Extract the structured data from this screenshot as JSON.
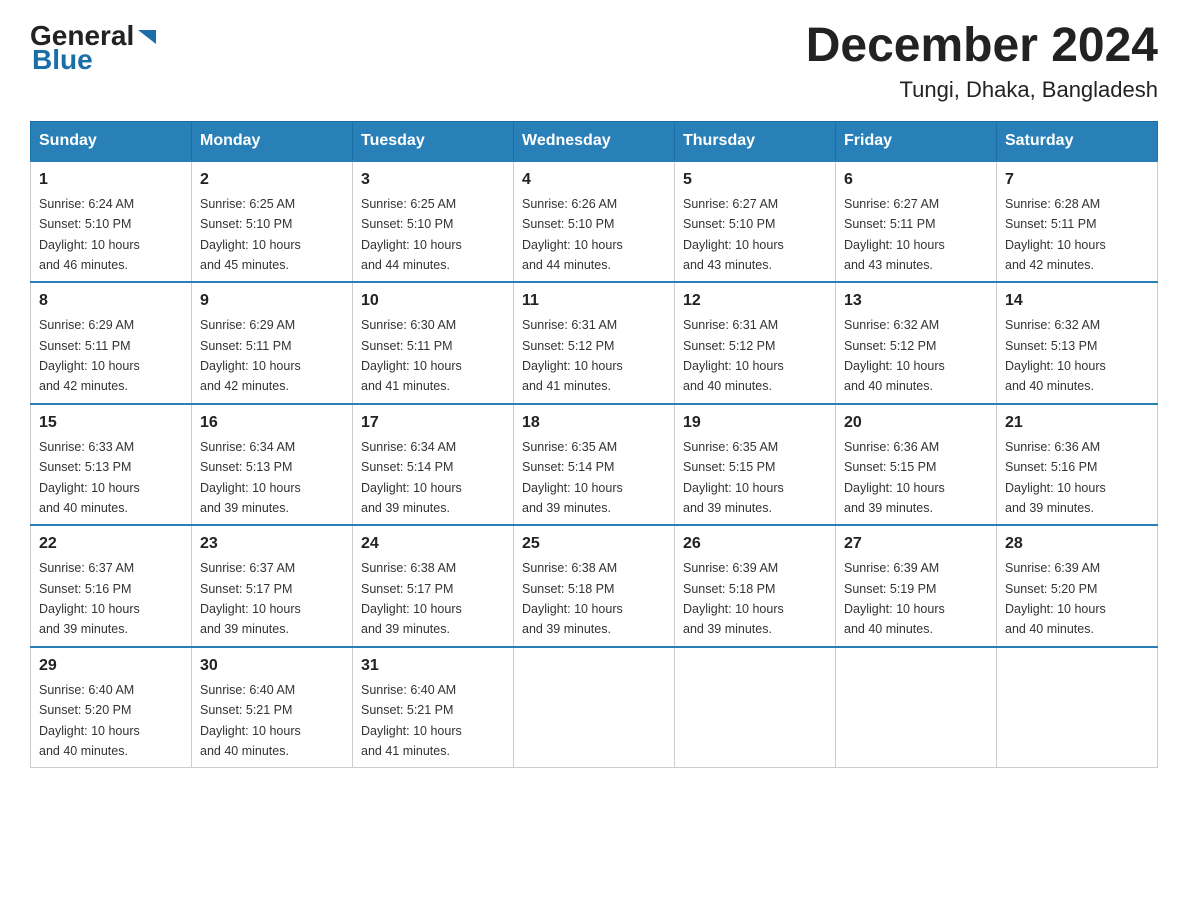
{
  "logo": {
    "general": "General",
    "blue": "Blue",
    "arrow": "▶"
  },
  "title": "December 2024",
  "subtitle": "Tungi, Dhaka, Bangladesh",
  "headers": [
    "Sunday",
    "Monday",
    "Tuesday",
    "Wednesday",
    "Thursday",
    "Friday",
    "Saturday"
  ],
  "weeks": [
    [
      {
        "day": "1",
        "info": "Sunrise: 6:24 AM\nSunset: 5:10 PM\nDaylight: 10 hours\nand 46 minutes."
      },
      {
        "day": "2",
        "info": "Sunrise: 6:25 AM\nSunset: 5:10 PM\nDaylight: 10 hours\nand 45 minutes."
      },
      {
        "day": "3",
        "info": "Sunrise: 6:25 AM\nSunset: 5:10 PM\nDaylight: 10 hours\nand 44 minutes."
      },
      {
        "day": "4",
        "info": "Sunrise: 6:26 AM\nSunset: 5:10 PM\nDaylight: 10 hours\nand 44 minutes."
      },
      {
        "day": "5",
        "info": "Sunrise: 6:27 AM\nSunset: 5:10 PM\nDaylight: 10 hours\nand 43 minutes."
      },
      {
        "day": "6",
        "info": "Sunrise: 6:27 AM\nSunset: 5:11 PM\nDaylight: 10 hours\nand 43 minutes."
      },
      {
        "day": "7",
        "info": "Sunrise: 6:28 AM\nSunset: 5:11 PM\nDaylight: 10 hours\nand 42 minutes."
      }
    ],
    [
      {
        "day": "8",
        "info": "Sunrise: 6:29 AM\nSunset: 5:11 PM\nDaylight: 10 hours\nand 42 minutes."
      },
      {
        "day": "9",
        "info": "Sunrise: 6:29 AM\nSunset: 5:11 PM\nDaylight: 10 hours\nand 42 minutes."
      },
      {
        "day": "10",
        "info": "Sunrise: 6:30 AM\nSunset: 5:11 PM\nDaylight: 10 hours\nand 41 minutes."
      },
      {
        "day": "11",
        "info": "Sunrise: 6:31 AM\nSunset: 5:12 PM\nDaylight: 10 hours\nand 41 minutes."
      },
      {
        "day": "12",
        "info": "Sunrise: 6:31 AM\nSunset: 5:12 PM\nDaylight: 10 hours\nand 40 minutes."
      },
      {
        "day": "13",
        "info": "Sunrise: 6:32 AM\nSunset: 5:12 PM\nDaylight: 10 hours\nand 40 minutes."
      },
      {
        "day": "14",
        "info": "Sunrise: 6:32 AM\nSunset: 5:13 PM\nDaylight: 10 hours\nand 40 minutes."
      }
    ],
    [
      {
        "day": "15",
        "info": "Sunrise: 6:33 AM\nSunset: 5:13 PM\nDaylight: 10 hours\nand 40 minutes."
      },
      {
        "day": "16",
        "info": "Sunrise: 6:34 AM\nSunset: 5:13 PM\nDaylight: 10 hours\nand 39 minutes."
      },
      {
        "day": "17",
        "info": "Sunrise: 6:34 AM\nSunset: 5:14 PM\nDaylight: 10 hours\nand 39 minutes."
      },
      {
        "day": "18",
        "info": "Sunrise: 6:35 AM\nSunset: 5:14 PM\nDaylight: 10 hours\nand 39 minutes."
      },
      {
        "day": "19",
        "info": "Sunrise: 6:35 AM\nSunset: 5:15 PM\nDaylight: 10 hours\nand 39 minutes."
      },
      {
        "day": "20",
        "info": "Sunrise: 6:36 AM\nSunset: 5:15 PM\nDaylight: 10 hours\nand 39 minutes."
      },
      {
        "day": "21",
        "info": "Sunrise: 6:36 AM\nSunset: 5:16 PM\nDaylight: 10 hours\nand 39 minutes."
      }
    ],
    [
      {
        "day": "22",
        "info": "Sunrise: 6:37 AM\nSunset: 5:16 PM\nDaylight: 10 hours\nand 39 minutes."
      },
      {
        "day": "23",
        "info": "Sunrise: 6:37 AM\nSunset: 5:17 PM\nDaylight: 10 hours\nand 39 minutes."
      },
      {
        "day": "24",
        "info": "Sunrise: 6:38 AM\nSunset: 5:17 PM\nDaylight: 10 hours\nand 39 minutes."
      },
      {
        "day": "25",
        "info": "Sunrise: 6:38 AM\nSunset: 5:18 PM\nDaylight: 10 hours\nand 39 minutes."
      },
      {
        "day": "26",
        "info": "Sunrise: 6:39 AM\nSunset: 5:18 PM\nDaylight: 10 hours\nand 39 minutes."
      },
      {
        "day": "27",
        "info": "Sunrise: 6:39 AM\nSunset: 5:19 PM\nDaylight: 10 hours\nand 40 minutes."
      },
      {
        "day": "28",
        "info": "Sunrise: 6:39 AM\nSunset: 5:20 PM\nDaylight: 10 hours\nand 40 minutes."
      }
    ],
    [
      {
        "day": "29",
        "info": "Sunrise: 6:40 AM\nSunset: 5:20 PM\nDaylight: 10 hours\nand 40 minutes."
      },
      {
        "day": "30",
        "info": "Sunrise: 6:40 AM\nSunset: 5:21 PM\nDaylight: 10 hours\nand 40 minutes."
      },
      {
        "day": "31",
        "info": "Sunrise: 6:40 AM\nSunset: 5:21 PM\nDaylight: 10 hours\nand 41 minutes."
      },
      {
        "day": "",
        "info": ""
      },
      {
        "day": "",
        "info": ""
      },
      {
        "day": "",
        "info": ""
      },
      {
        "day": "",
        "info": ""
      }
    ]
  ]
}
